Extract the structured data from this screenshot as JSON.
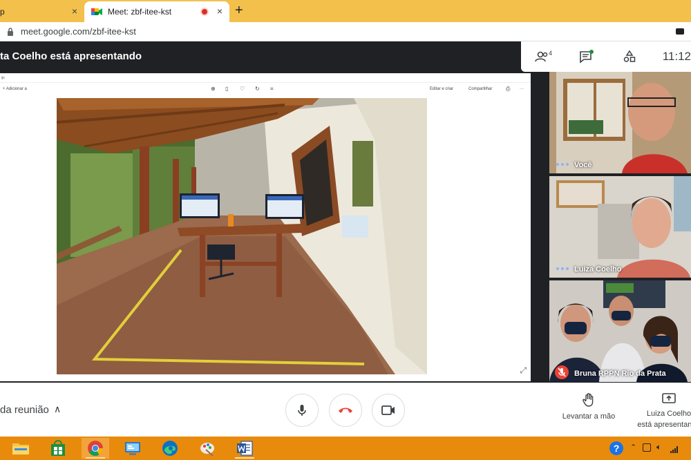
{
  "browser": {
    "tabs": [
      {
        "label": "p",
        "active": false
      },
      {
        "label": "Meet: zbf-itee-kst",
        "active": true
      }
    ],
    "close_glyph": "×",
    "new_tab_glyph": "+",
    "url": "meet.google.com/zbf-itee-kst"
  },
  "meet": {
    "presenting_text": "ta Coelho está apresentando",
    "participants_count": "4",
    "clock": "11:12",
    "shared_app": {
      "top_text": "ijs",
      "add_label": "+ Adicionar a",
      "edit_label": "Editar e criar",
      "share_label": "Compartilhar",
      "more_glyph": "···"
    },
    "participants": [
      {
        "name": "Você",
        "muted": false
      },
      {
        "name": "Luiza Coelho",
        "muted": false
      },
      {
        "name": "Bruna RPPN Rio da Prata",
        "muted": true
      }
    ],
    "controls": {
      "details_label": "da reunião",
      "chevron_glyph": "∧",
      "raise_hand_label": "Levantar a mão",
      "presenting_label_line1": "Luiza Coelho",
      "presenting_label_line2": "está apresentando"
    }
  },
  "taskbar": {
    "apps": [
      "file-explorer",
      "store",
      "chrome",
      "control-panel",
      "edge",
      "paint",
      "word"
    ],
    "help_glyph": "?"
  },
  "colors": {
    "tabstrip": "#f2c04b",
    "taskbar": "#e88b0c",
    "meet_dark": "#202124",
    "end_call_red": "#ea4335"
  }
}
